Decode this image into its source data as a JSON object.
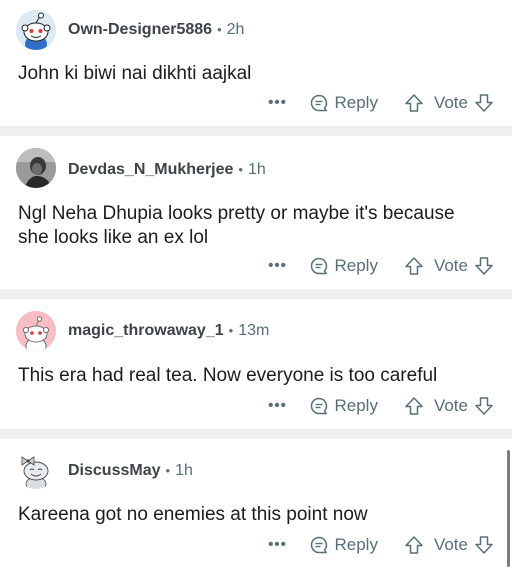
{
  "comments": [
    {
      "username": "Own-Designer5886",
      "age": "2h",
      "separator": "•",
      "text": "John ki biwi nai dikhti aajkal",
      "avatar": "snoo-avatar-blue",
      "more_label": "•••",
      "reply_label": "Reply",
      "vote_label": "Vote"
    },
    {
      "username": "Devdas_N_Mukherjee",
      "age": "1h",
      "separator": "•",
      "text": "Ngl Neha Dhupia looks pretty or maybe it's because she looks like an ex lol",
      "avatar": "photo-avatar",
      "more_label": "•••",
      "reply_label": "Reply",
      "vote_label": "Vote"
    },
    {
      "username": "magic_throwaway_1",
      "age": "13m",
      "separator": "•",
      "text": "This era had real tea. Now everyone is too careful",
      "avatar": "snoo-avatar-pink",
      "more_label": "•••",
      "reply_label": "Reply",
      "vote_label": "Vote"
    },
    {
      "username": "DiscussMay",
      "age": "1h",
      "separator": "•",
      "text": "Kareena got no enemies at this point now",
      "avatar": "snoo-avatar-bow",
      "more_label": "•••",
      "reply_label": "Reply",
      "vote_label": "Vote"
    }
  ],
  "colors": {
    "divider": "#edeff1",
    "meta": "#576f76",
    "text": "#1c1c1c"
  }
}
